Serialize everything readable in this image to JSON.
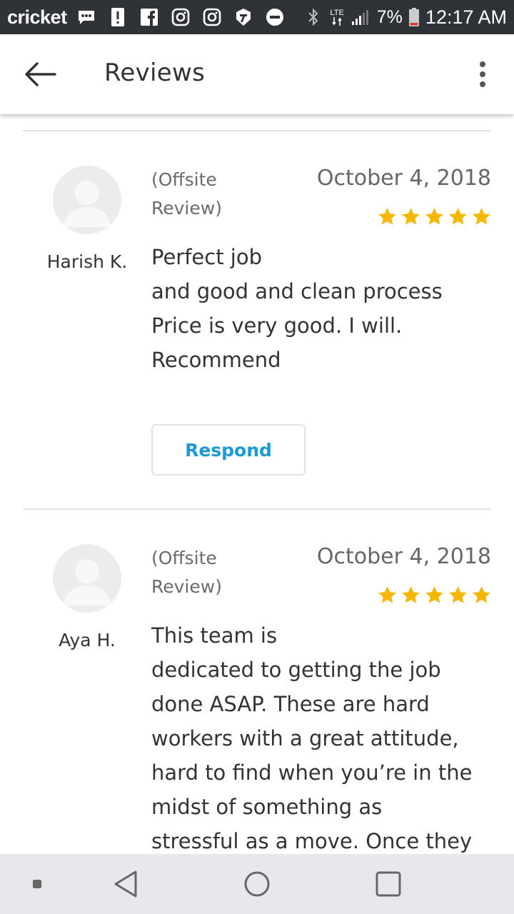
{
  "status_bar": {
    "carrier": "cricket",
    "network": "LTE",
    "battery": "7%",
    "time": "12:17 AM"
  },
  "app_bar": {
    "title": "Reviews"
  },
  "reviews": [
    {
      "name": "Harish K.",
      "source": "(Offsite\nReview)",
      "date": "October 4, 2018",
      "rating": 5,
      "text": "Perfect job\nand good and clean process\nPrice is very good. I will.\nRecommend",
      "respond_label": "Respond"
    },
    {
      "name": "Aya H.",
      "source": "(Offsite\nReview)",
      "date": "October 4, 2018",
      "rating": 5,
      "text": "This team is\ndedicated to getting the job\ndone ASAP. These are hard\nworkers with a great attitude,\nhard to find when you’re in the\nmidst of something as\nstressful as a move. Once they"
    }
  ],
  "colors": {
    "star": "#f5b700",
    "accent": "#1a9ad6",
    "status_bar": "#2f3236",
    "nav_bar": "#e8e8ec"
  }
}
